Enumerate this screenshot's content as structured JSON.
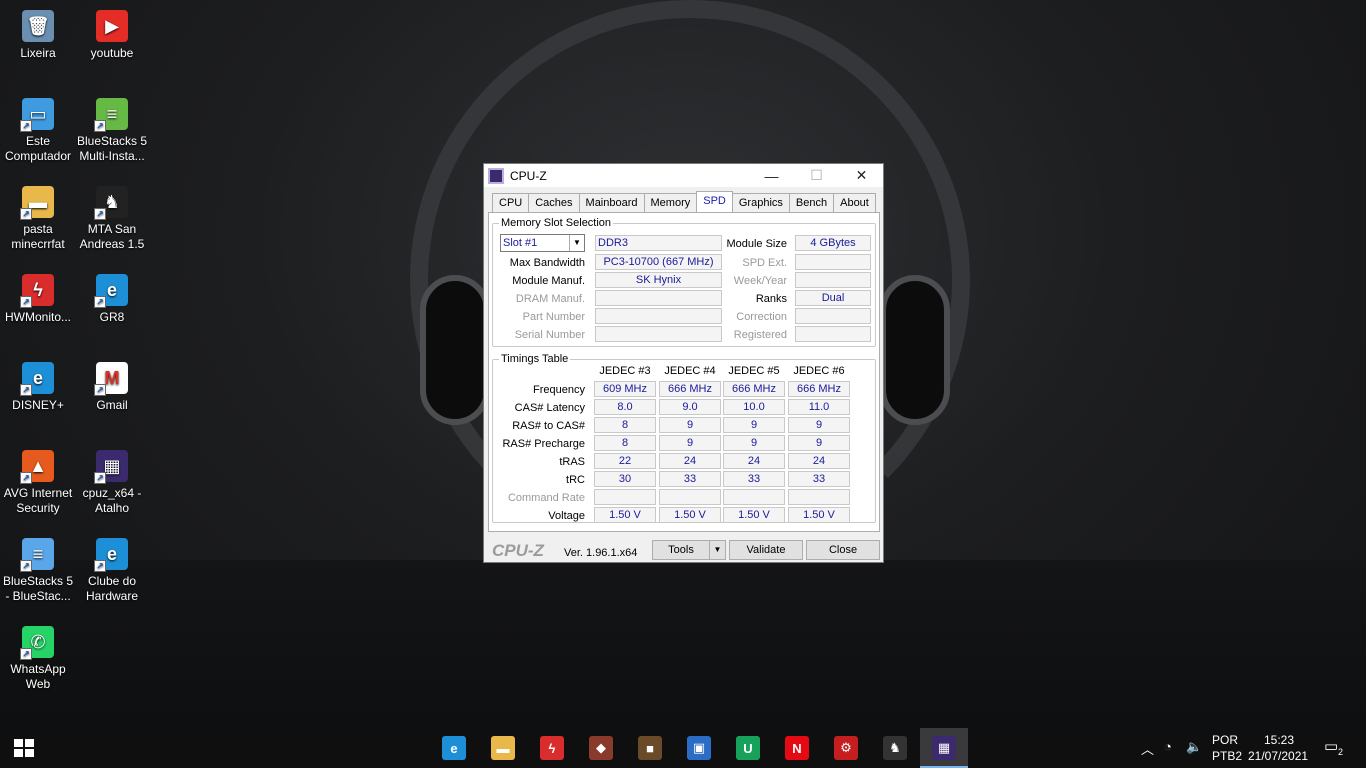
{
  "desktop": {
    "icons": [
      {
        "label": "Lixeira",
        "icon": "recycle-bin-icon",
        "color": "#6a8fb0"
      },
      {
        "label": "youtube",
        "icon": "youtube-icon",
        "color": "#e52d27"
      },
      {
        "label": "Este Computador",
        "icon": "computer-icon",
        "color": "#3f9be0"
      },
      {
        "label": "BlueStacks 5 Multi-Insta...",
        "icon": "bluestacks-icon",
        "color": "#66b945"
      },
      {
        "label": "pasta minecrrfat",
        "icon": "folder-icon",
        "color": "#e8b84a"
      },
      {
        "label": "MTA San Andreas 1.5",
        "icon": "mta-icon",
        "color": "#222222"
      },
      {
        "label": "HWMonito...",
        "icon": "hwmonitor-icon",
        "color": "#d92c2c"
      },
      {
        "label": "GR8",
        "icon": "edge-icon",
        "color": "#1d8fd6"
      },
      {
        "label": "DISNEY+",
        "icon": "edge-icon",
        "color": "#1d8fd6"
      },
      {
        "label": "Gmail",
        "icon": "gmail-icon",
        "color": "#ffffff"
      },
      {
        "label": "AVG Internet Security",
        "icon": "avg-icon",
        "color": "#e65b1d"
      },
      {
        "label": "cpuz_x64 - Atalho",
        "icon": "cpuz-icon",
        "color": "#3b2a6e"
      },
      {
        "label": "BlueStacks 5 - BlueStac...",
        "icon": "bluestacks-icon",
        "color": "#5aa6e8"
      },
      {
        "label": "Clube do Hardware",
        "icon": "edge-icon",
        "color": "#1d8fd6"
      },
      {
        "label": "WhatsApp Web",
        "icon": "whatsapp-icon",
        "color": "#25d366"
      }
    ]
  },
  "window": {
    "title": "CPU-Z",
    "minimize": "—",
    "maximize": "☐",
    "close": "✕",
    "tabs": [
      "CPU",
      "Caches",
      "Mainboard",
      "Memory",
      "SPD",
      "Graphics",
      "Bench",
      "About"
    ],
    "active_tab": "SPD",
    "memory_slot": {
      "legend": "Memory Slot Selection",
      "slot": "Slot #1",
      "type": "DDR3",
      "module_size_label": "Module Size",
      "module_size": "4 GBytes",
      "max_bandwidth_label": "Max Bandwidth",
      "max_bandwidth": "PC3-10700 (667 MHz)",
      "spd_ext_label": "SPD Ext.",
      "spd_ext": "",
      "module_manuf_label": "Module Manuf.",
      "module_manuf": "SK Hynix",
      "week_year_label": "Week/Year",
      "week_year": "",
      "dram_manuf_label": "DRAM Manuf.",
      "dram_manuf": "",
      "ranks_label": "Ranks",
      "ranks": "Dual",
      "part_number_label": "Part Number",
      "part_number": "",
      "correction_label": "Correction",
      "correction": "",
      "serial_number_label": "Serial Number",
      "serial_number": "",
      "registered_label": "Registered",
      "registered": ""
    },
    "timings": {
      "legend": "Timings Table",
      "columns": [
        "JEDEC #3",
        "JEDEC #4",
        "JEDEC #5",
        "JEDEC #6"
      ],
      "rows": [
        {
          "label": "Frequency",
          "values": [
            "609 MHz",
            "666 MHz",
            "666 MHz",
            "666 MHz"
          ]
        },
        {
          "label": "CAS# Latency",
          "values": [
            "8.0",
            "9.0",
            "10.0",
            "11.0"
          ]
        },
        {
          "label": "RAS# to CAS#",
          "values": [
            "8",
            "9",
            "9",
            "9"
          ]
        },
        {
          "label": "RAS# Precharge",
          "values": [
            "8",
            "9",
            "9",
            "9"
          ]
        },
        {
          "label": "tRAS",
          "values": [
            "22",
            "24",
            "24",
            "24"
          ]
        },
        {
          "label": "tRC",
          "values": [
            "30",
            "33",
            "33",
            "33"
          ]
        },
        {
          "label": "Command Rate",
          "values": [
            "",
            "",
            "",
            ""
          ]
        },
        {
          "label": "Voltage",
          "values": [
            "1.50 V",
            "1.50 V",
            "1.50 V",
            "1.50 V"
          ]
        }
      ]
    },
    "footer": {
      "brand": "CPU-Z",
      "version": "Ver. 1.96.1.x64",
      "tools": "Tools",
      "validate": "Validate",
      "close": "Close"
    }
  },
  "taskbar": {
    "apps": [
      {
        "icon": "edge-icon",
        "color": "#1d8fd6",
        "glyph": "e"
      },
      {
        "icon": "file-explorer-icon",
        "color": "#e8b84a",
        "glyph": "▬"
      },
      {
        "icon": "hwmonitor-icon",
        "color": "#d92c2c",
        "glyph": "ϟ"
      },
      {
        "icon": "game-icon",
        "color": "#8a3a2a",
        "glyph": "◆"
      },
      {
        "icon": "minecraft-icon",
        "color": "#6b4a2a",
        "glyph": "■"
      },
      {
        "icon": "store-icon",
        "color": "#2b6cc4",
        "glyph": "▣"
      },
      {
        "icon": "utorrent-icon",
        "color": "#17a25b",
        "glyph": "U"
      },
      {
        "icon": "netflix-icon",
        "color": "#e50914",
        "glyph": "N"
      },
      {
        "icon": "gear-app-icon",
        "color": "#c41e1e",
        "glyph": "⚙"
      },
      {
        "icon": "mta-icon",
        "color": "#333333",
        "glyph": "♞"
      },
      {
        "icon": "cpuz-icon",
        "color": "#3b2a6e",
        "glyph": "▦"
      }
    ],
    "lang_top": "POR",
    "lang_bottom": "PTB2",
    "time": "15:23",
    "date": "21/07/2021",
    "notifications": "2"
  }
}
